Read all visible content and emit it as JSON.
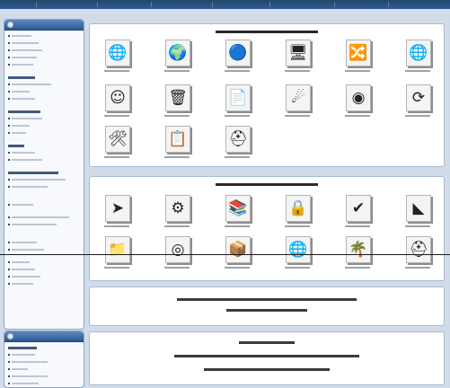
{
  "window": {
    "title": ""
  },
  "colors": {
    "accent": "#2b5a93",
    "page_background": "#d2dce9",
    "panel_border": "#a9bbd2"
  },
  "sidebar": {
    "admin_box": {
      "title": "",
      "icon": "info-icon",
      "rows": 41
    },
    "user_box": {
      "title": "",
      "icon": "info-icon",
      "rows": 8
    }
  },
  "admin_panel": {
    "title": "",
    "items": [
      {
        "label": "",
        "icon": "globe-puzzle-icon"
      },
      {
        "label": "",
        "icon": "globe-people-icon"
      },
      {
        "label": "",
        "icon": "colored-balls-icon"
      },
      {
        "label": "",
        "icon": "workstation-icon"
      },
      {
        "label": "",
        "icon": "network-icon"
      },
      {
        "label": "",
        "icon": "net-globe-icon"
      },
      {
        "label": "",
        "icon": "smiley-icon"
      },
      {
        "label": "",
        "icon": "trash-bin-icon"
      },
      {
        "label": "",
        "icon": "web-page-icon"
      },
      {
        "label": "",
        "icon": "meteor-icon"
      },
      {
        "label": "",
        "icon": "web-globe-icon"
      },
      {
        "label": "",
        "icon": "refresh-globe-icon"
      },
      {
        "label": "",
        "icon": "tools-icon"
      },
      {
        "label": "",
        "icon": "notepad-icon"
      },
      {
        "label": "",
        "icon": "logout-helmet-icon"
      }
    ]
  },
  "modules_panel": {
    "title": "",
    "items": [
      {
        "label": "",
        "icon": "arrow-box-icon"
      },
      {
        "label": "",
        "icon": "gear-star-icon"
      },
      {
        "label": "",
        "icon": "books-icon"
      },
      {
        "label": "",
        "icon": "lock-users-icon"
      },
      {
        "label": "",
        "icon": "chart-check-icon"
      },
      {
        "label": "",
        "icon": "corner-chart-icon"
      },
      {
        "label": "",
        "icon": "folder-icon"
      },
      {
        "label": "",
        "icon": "globe-disc-icon"
      },
      {
        "label": "",
        "icon": "package-icon"
      },
      {
        "label": "",
        "icon": "network-globe-icon"
      },
      {
        "label": "",
        "icon": "palm-tree-icon"
      },
      {
        "label": "",
        "icon": "dark-helmet-icon"
      }
    ]
  },
  "info_box": {
    "line1": "",
    "line2": ""
  },
  "whos_online_box": {
    "title": "",
    "line1": "",
    "line2": ""
  }
}
